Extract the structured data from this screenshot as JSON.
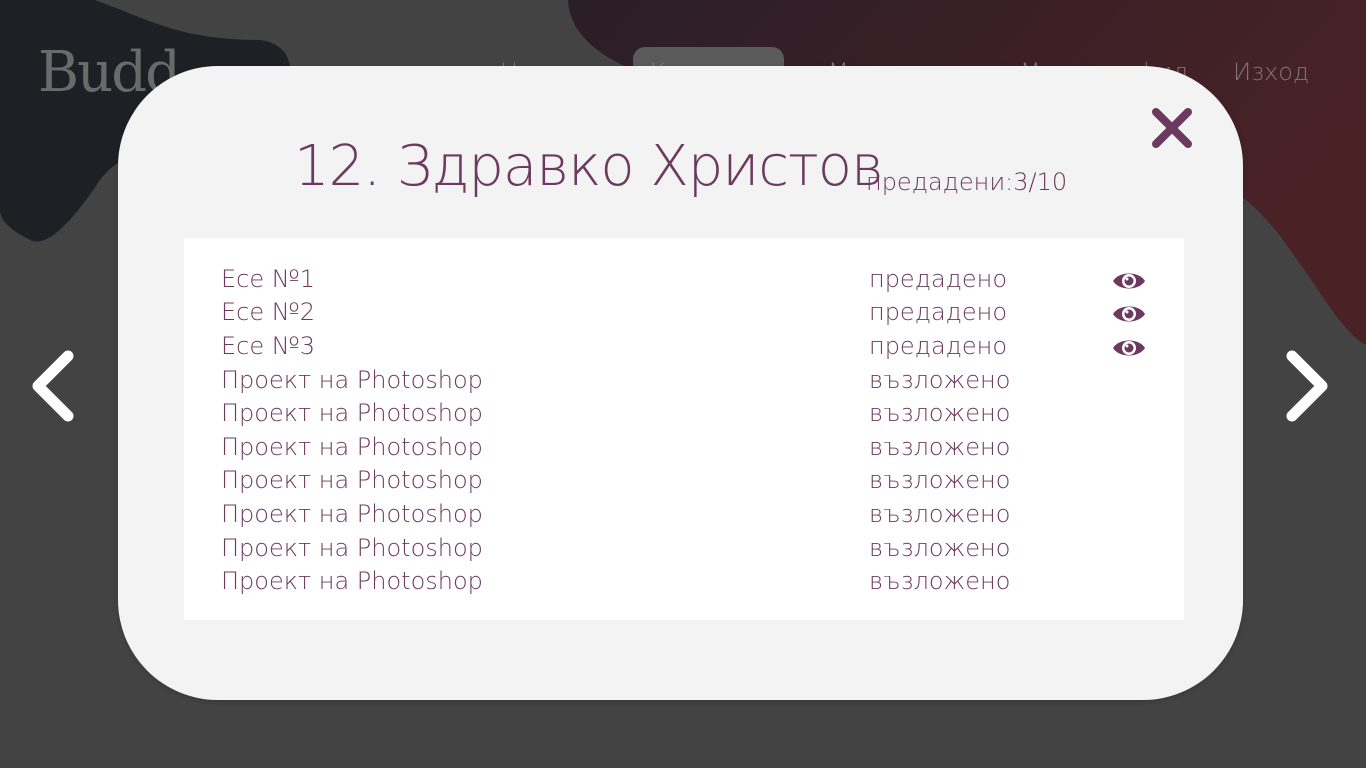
{
  "app": {
    "logo_text": "Budd"
  },
  "nav": {
    "items": [
      {
        "label": "Начало"
      },
      {
        "label": "Класове"
      },
      {
        "label": "Материали"
      },
      {
        "label": "Моят профил"
      },
      {
        "label": "Изход"
      }
    ],
    "active_index": 1
  },
  "modal": {
    "title": "12. Здравко Христов",
    "handed_in": "предадени:3/10",
    "rows": [
      {
        "name": "Есе №1",
        "status": "предадено",
        "icon": "eye-icon"
      },
      {
        "name": "Есе №2",
        "status": "предадено",
        "icon": "eye-icon"
      },
      {
        "name": "Есе №3",
        "status": "предадено",
        "icon": "eye-icon"
      },
      {
        "name": "Проект на Photoshop",
        "status": "възложено"
      },
      {
        "name": "Проект на Photoshop",
        "status": "възложено"
      },
      {
        "name": "Проект на Photoshop",
        "status": "възложено"
      },
      {
        "name": "Проект на Photoshop",
        "status": "възложено"
      },
      {
        "name": "Проект на Photoshop",
        "status": "възложено"
      },
      {
        "name": "Проект на Photoshop",
        "status": "възложено"
      },
      {
        "name": "Проект на Photoshop",
        "status": "възложено"
      }
    ]
  },
  "icons": {
    "close": "close-icon",
    "prev": "chevron-left-icon",
    "next": "chevron-right-icon",
    "view": "eye-icon"
  },
  "colors": {
    "accent": "#6b3a5e",
    "modal_bg": "#f3f3f3",
    "list_bg": "#ffffff",
    "page_bg": "#434343"
  }
}
